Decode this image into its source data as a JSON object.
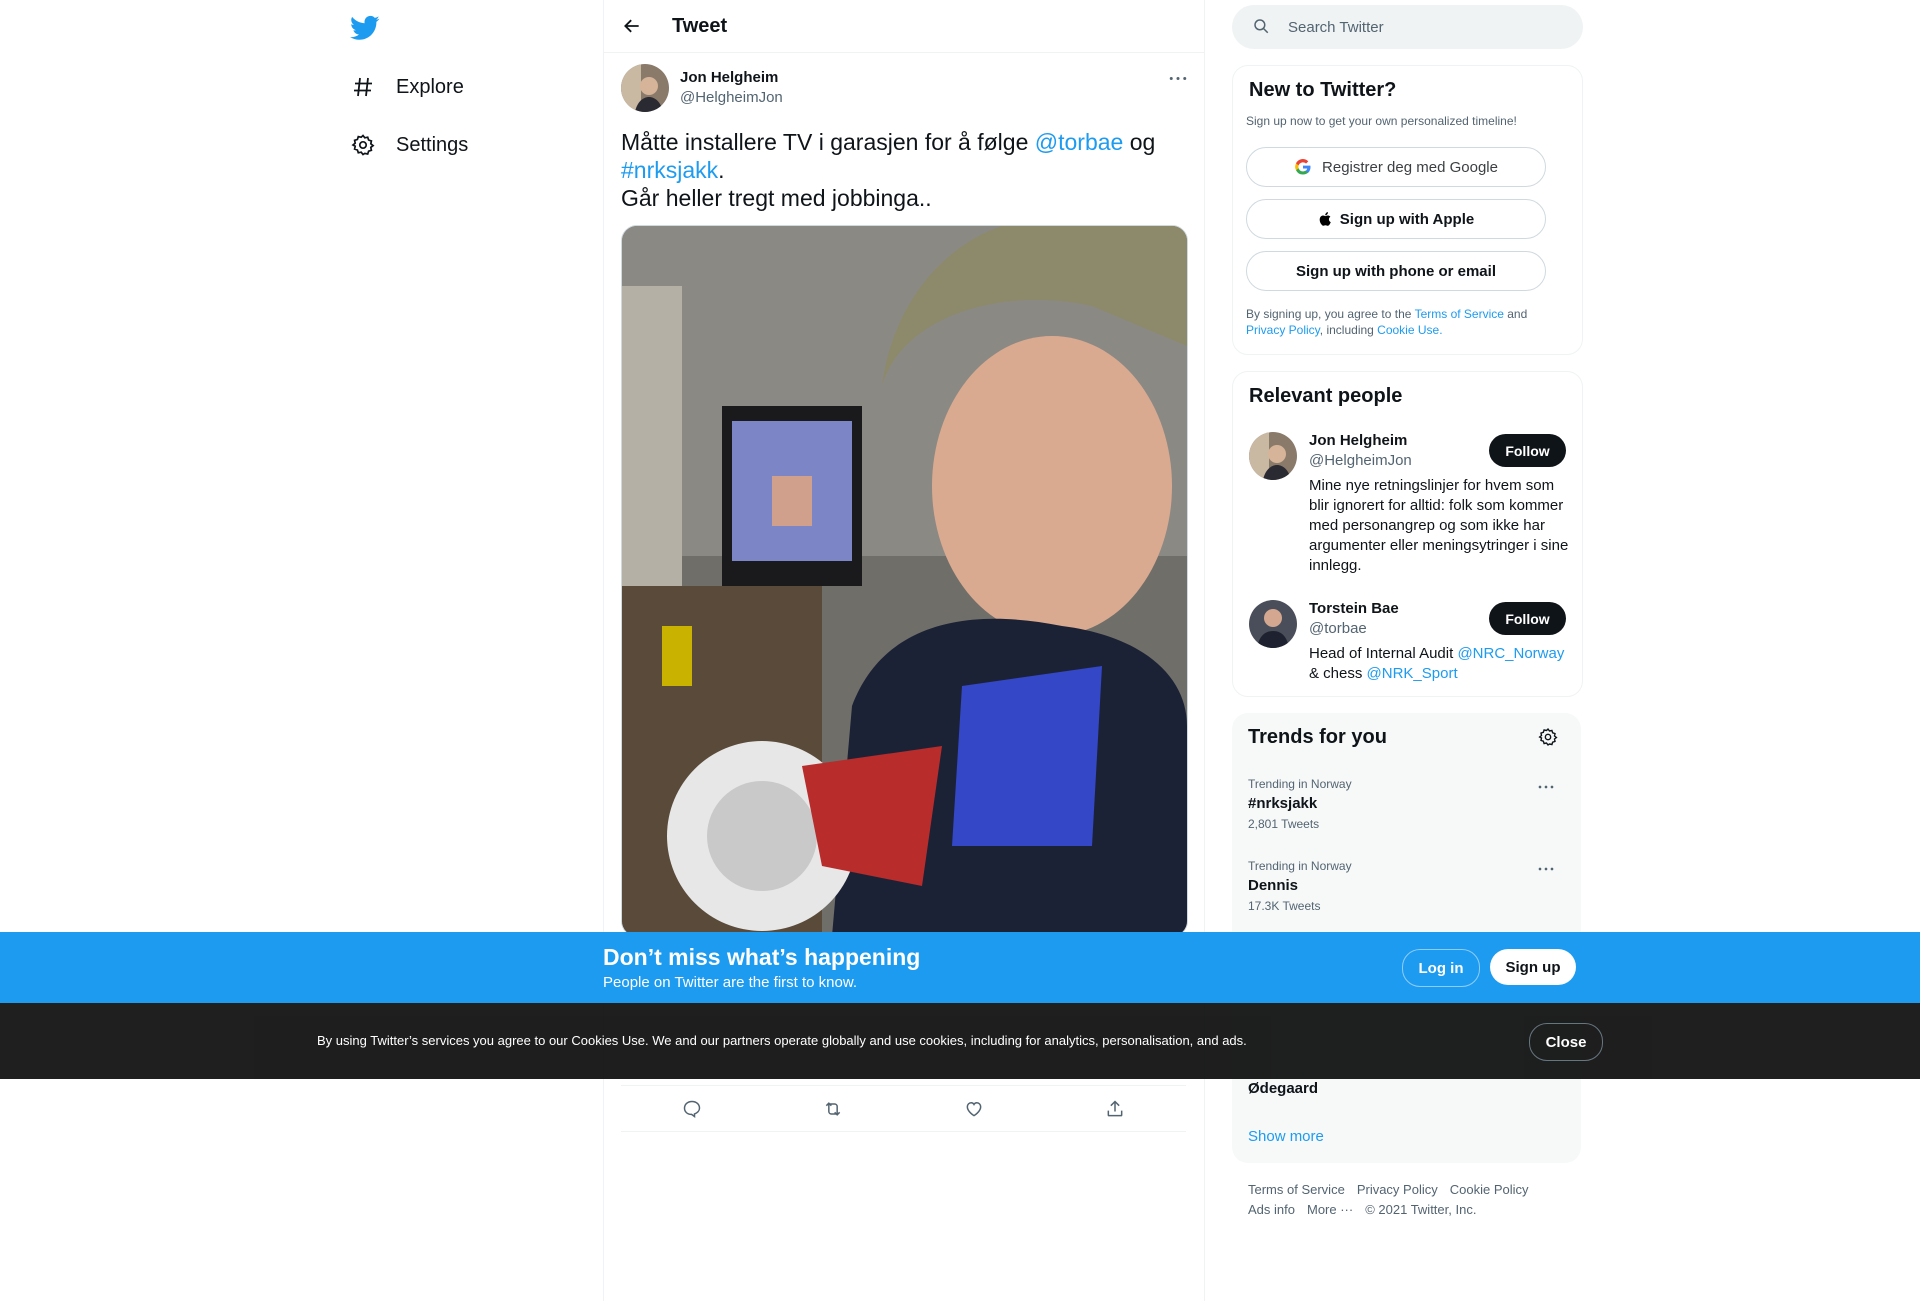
{
  "nav": {
    "logo": "twitter-bird-icon",
    "items": [
      {
        "label": "Explore",
        "icon": "hashtag-icon"
      },
      {
        "label": "Settings",
        "icon": "gear-icon"
      }
    ]
  },
  "header": {
    "title": "Tweet"
  },
  "tweet": {
    "author_name": "Jon Helgheim",
    "author_handle": "@HelgheimJon",
    "text_part1": "Måtte installere TV i garasjen for å følge ",
    "mention": "@torbae",
    "text_part2": " og ",
    "hashtag": "#nrksjakk",
    "text_part3": ".",
    "text_line2": "Går heller tregt med jobbinga.."
  },
  "search": {
    "placeholder": "Search Twitter"
  },
  "new_to_twitter": {
    "title": "New to Twitter?",
    "subtitle": "Sign up now to get your own personalized timeline!",
    "google_label": "Registrer deg med Google",
    "apple_label": "Sign up with Apple",
    "phone_label": "Sign up with phone or email",
    "legal_prefix": "By signing up, you agree to the ",
    "tos": "Terms of Service",
    "and": " and",
    "privacy": "Privacy Policy",
    "including": ", including ",
    "cookie_use": "Cookie Use."
  },
  "relevant_people": {
    "title": "Relevant people",
    "people": [
      {
        "name": "Jon Helgheim",
        "handle": "@HelgheimJon",
        "follow": "Follow",
        "bio": "Mine nye retningslinjer for hvem som blir ignorert for alltid: folk som kommer med personangrep og som ikke har argumenter eller meningsytringer i sine innlegg."
      },
      {
        "name": "Torstein Bae",
        "handle": "@torbae",
        "follow": "Follow",
        "bio_prefix": "Head of Internal Audit ",
        "bio_link1": "@NRC_Norway",
        "bio_mid": "& chess ",
        "bio_link2": "@NRK_Sport"
      }
    ]
  },
  "trends": {
    "title": "Trends for you",
    "items": [
      {
        "context": "Trending in Norway",
        "name": "#nrksjakk",
        "count": "2,801 Tweets"
      },
      {
        "context": "Trending in Norway",
        "name": "Dennis",
        "count": "17.3K Tweets"
      }
    ],
    "partial_item": "Ødegaard",
    "show_more": "Show more"
  },
  "footer": {
    "links": [
      "Terms of Service",
      "Privacy Policy",
      "Cookie Policy",
      "Ads info",
      "More ···"
    ],
    "copyright": "© 2021 Twitter, Inc."
  },
  "banner": {
    "title": "Don’t miss what’s happening",
    "subtitle": "People on Twitter are the first to know.",
    "login": "Log in",
    "signup": "Sign up"
  },
  "cookie": {
    "text": "By using Twitter’s services you agree to our Cookies Use. We and our partners operate globally and use cookies, including for analytics, personalisation, and ads.",
    "close": "Close"
  },
  "colors": {
    "accent": "#1d9bf0",
    "text": "#0f1419",
    "secondary": "#536471"
  }
}
